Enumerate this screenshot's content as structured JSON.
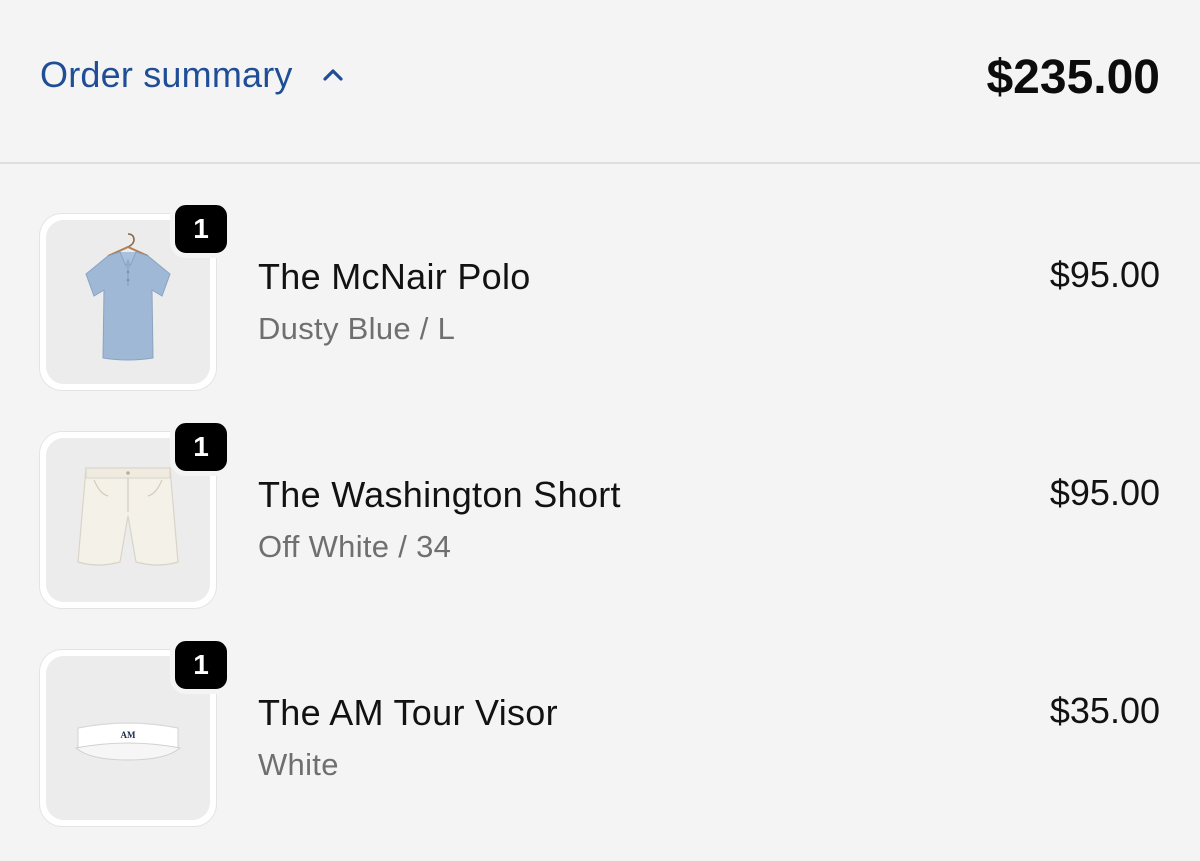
{
  "summary": {
    "label": "Order summary",
    "toggle_icon": "chevron-up-icon",
    "total": "$235.00",
    "accent_color": "#1f4e96"
  },
  "items": [
    {
      "quantity": "1",
      "name": "The McNair Polo",
      "variant": "Dusty Blue / L",
      "price": "$95.00",
      "image": "polo-shirt-image"
    },
    {
      "quantity": "1",
      "name": "The Washington Short",
      "variant": "Off White / 34",
      "price": "$95.00",
      "image": "shorts-image"
    },
    {
      "quantity": "1",
      "name": "The AM Tour Visor",
      "variant": "White",
      "price": "$35.00",
      "image": "visor-image",
      "image_text": "AM"
    }
  ]
}
